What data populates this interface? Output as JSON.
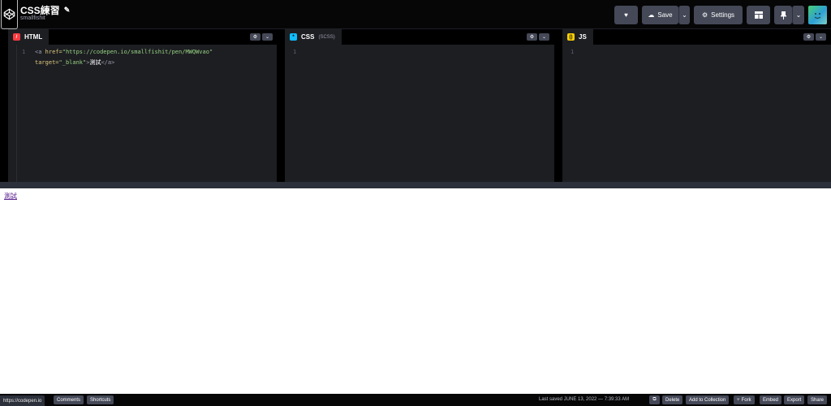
{
  "header": {
    "title": "CSS練習",
    "owner": "smallfishit",
    "buttons": {
      "save": "Save",
      "settings": "Settings"
    }
  },
  "editors": {
    "html": {
      "label": "HTML",
      "color": "#ff3c41",
      "code_line1_tag_open": "<a",
      "code_line1_attr": " href=",
      "code_line1_value": "\"https://codepen.io/smallfishit/pen/MWQWvao\"",
      "code_line2_attr": "target=",
      "code_line2_value": "\"_blank\"",
      "code_line2_close": ">",
      "code_line2_text": "測試",
      "code_line2_end": "</a>",
      "line_number": "1"
    },
    "css": {
      "label": "CSS",
      "sublabel": "(SCSS)",
      "color": "#0ebeff",
      "line_number": "1"
    },
    "js": {
      "label": "JS",
      "color": "#fcd000",
      "line_number": "1"
    }
  },
  "preview": {
    "link_text": "測試"
  },
  "footer": {
    "status_url": "https://codepen.io",
    "comments": "Comments",
    "shortcuts": "Shortcuts",
    "last_saved": "Last saved JUNE 13, 2022 — 7:39:33 AM",
    "delete": "Delete",
    "add_to_collection": "Add to Collection",
    "fork": "Fork",
    "embed": "Embed",
    "export": "Export",
    "share": "Share"
  },
  "icons": {
    "logo": "codepen-logo-icon",
    "edit": "pencil-icon",
    "heart": "heart-icon",
    "cloud": "cloud-icon",
    "gear": "gear-icon",
    "layout": "layout-icon",
    "pin": "pin-icon",
    "chevron": "chevron-down-icon",
    "external": "external-link-icon",
    "fork": "fork-icon"
  }
}
